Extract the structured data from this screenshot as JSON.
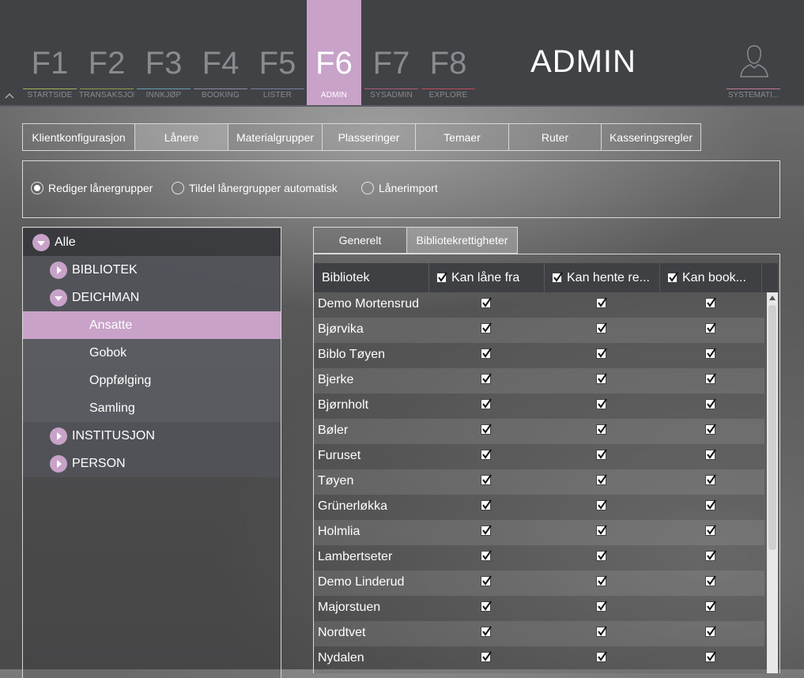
{
  "topbar": {
    "fkeys": [
      {
        "num": "F1",
        "label": "STARTSIDE",
        "color": "#a4b45a"
      },
      {
        "num": "F2",
        "label": "TRANSAKSJON",
        "color": "#8aa04a"
      },
      {
        "num": "F3",
        "label": "INNKJØP",
        "color": "#6e9ab8"
      },
      {
        "num": "F4",
        "label": "BOOKING",
        "color": "#8f8aa8"
      },
      {
        "num": "F5",
        "label": "LISTER",
        "color": "#7a7fa0"
      },
      {
        "num": "F6",
        "label": "ADMIN",
        "color": "#c8a2c8"
      },
      {
        "num": "F7",
        "label": "SYSADMIN",
        "color": "#b05a7a"
      },
      {
        "num": "F8",
        "label": "EXPLORE",
        "color": "#c04a5a"
      }
    ],
    "active_key": "F6",
    "page_title": "ADMIN",
    "user_label": "SYSTEMATI..."
  },
  "main_tabs": [
    "Klientkonfigurasjon",
    "Lånere",
    "Materialgrupper",
    "Plasseringer",
    "Temaer",
    "Ruter",
    "Kasseringsregler"
  ],
  "active_main_tab": "Lånere",
  "radios": [
    {
      "label": "Rediger lånergrupper",
      "selected": true
    },
    {
      "label": "Tildel lånergrupper automatisk",
      "selected": false
    },
    {
      "label": "Lånerimport",
      "selected": false
    }
  ],
  "tree": [
    {
      "label": "Alle",
      "level": 0,
      "toggle": "down"
    },
    {
      "label": "BIBLIOTEK",
      "level": 1,
      "toggle": "right"
    },
    {
      "label": "DEICHMAN",
      "level": 1,
      "toggle": "down"
    },
    {
      "label": "Ansatte",
      "level": 2,
      "selected": true
    },
    {
      "label": "Gobok",
      "level": 2
    },
    {
      "label": "Oppfølging",
      "level": 2
    },
    {
      "label": "Samling",
      "level": 2
    },
    {
      "label": "INSTITUSJON",
      "level": 1,
      "toggle": "right"
    },
    {
      "label": "PERSON",
      "level": 1,
      "toggle": "right"
    }
  ],
  "sub_tabs": [
    "Generelt",
    "Bibliotekrettigheter"
  ],
  "active_sub_tab": "Bibliotekrettigheter",
  "grid": {
    "columns": [
      "Bibliotek",
      "Kan låne fra",
      "Kan hente re...",
      "Kan book..."
    ],
    "header_checked": [
      true,
      true,
      true
    ],
    "rows": [
      {
        "name": "Demo Mortensrud",
        "checks": [
          true,
          true,
          true
        ]
      },
      {
        "name": "Bjørvika",
        "checks": [
          true,
          true,
          true
        ]
      },
      {
        "name": "Biblo Tøyen",
        "checks": [
          true,
          true,
          true
        ]
      },
      {
        "name": "Bjerke",
        "checks": [
          true,
          true,
          true
        ]
      },
      {
        "name": "Bjørnholt",
        "checks": [
          true,
          true,
          true
        ]
      },
      {
        "name": "Bøler",
        "checks": [
          true,
          true,
          true
        ]
      },
      {
        "name": "Furuset",
        "checks": [
          true,
          true,
          true
        ]
      },
      {
        "name": "Tøyen",
        "checks": [
          true,
          true,
          true
        ]
      },
      {
        "name": "Grünerløkka",
        "checks": [
          true,
          true,
          true
        ]
      },
      {
        "name": "Holmlia",
        "checks": [
          true,
          true,
          true
        ]
      },
      {
        "name": "Lambertseter",
        "checks": [
          true,
          true,
          true
        ]
      },
      {
        "name": "Demo Linderud",
        "checks": [
          true,
          true,
          true
        ]
      },
      {
        "name": "Majorstuen",
        "checks": [
          true,
          true,
          true
        ]
      },
      {
        "name": "Nordtvet",
        "checks": [
          true,
          true,
          true
        ]
      },
      {
        "name": "Nydalen",
        "checks": [
          true,
          true,
          true
        ]
      }
    ]
  }
}
